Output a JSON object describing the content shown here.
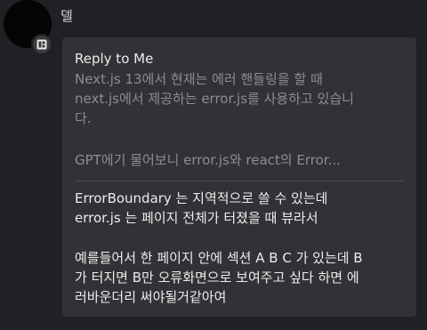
{
  "sender": {
    "name": "델"
  },
  "reply": {
    "title": "Reply to Me",
    "quote_lines": [
      "Next.js 13에서 현재는 에러 핸들링을 할 때",
      "next.js에서 제공하는 error.js를 사용하고 있습니",
      "다.",
      "GPT에기 물어보니 error.js와 react의 Error..."
    ]
  },
  "message": {
    "lines": [
      "ErrorBoundary 는 지역적으로 쓸 수 있는데",
      "error.js 는 페이지 전체가 터졌을 때 뷰라서",
      "예를들어서 한 페이지 안에 섹션 A B C 가 있는데 B",
      "가 터지면 B만 오류화면으로 보여주고 싶다 하면 에",
      "러바운더리 써야될거같아여"
    ]
  },
  "colors": {
    "background": "#202124",
    "bubble": "#313235",
    "quote_text": "#8c8d90",
    "message_text": "#ececec"
  },
  "icons": {
    "badge": "app-badge-icon"
  }
}
